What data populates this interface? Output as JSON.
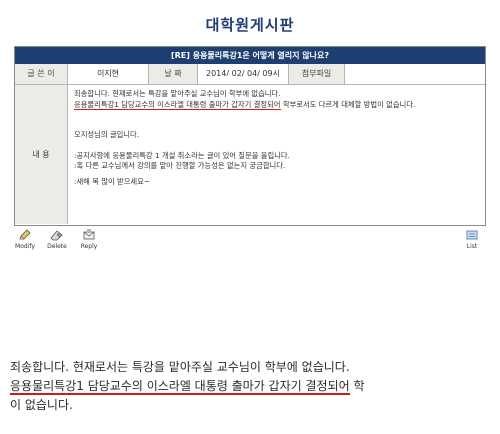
{
  "board": {
    "title": "대학원게시판"
  },
  "post": {
    "subject": "[RE] 응용물리특강1은 어떻게 열리지 않나요?",
    "meta": {
      "author_label": "글 쓴 이",
      "author": "이지현",
      "date_label": "날 짜",
      "date": "2014/ 02/ 04/ 09시",
      "attach_label": "첨부파일",
      "attach_value": ""
    },
    "content_label": "내 용",
    "content": {
      "line1": "죄송합니다. 현재로서는 특강을 맡아주실 교수님이 학부에 없습니다.",
      "line2_underlined": "응용물리특강1 담당교수의 이스라엘 대통령 출마가 갑자기 결정되어",
      "line2_rest": " 학부로서도 다르게 대체할 방법이 없습니다.",
      "line3": "오지성님의 글입니다.",
      "line4": ":공지사항에 응용물리특강 1 개설 취소라는 글이 있어 질문을 올립니다.",
      "line5": ":혹 다른 교수님께서 강의를 맡아 진행할 가능성은 없는지 궁금합니다.",
      "line6": ":새해 복 많이 받으세요~"
    }
  },
  "actions": {
    "modify_label": "Modify",
    "delete_label": "Delete",
    "reply_label": "Reply",
    "list_label": "List"
  },
  "zoom": {
    "line1": "죄송합니다. 현재로서는 특강을 맡아주실 교수님이 학부에 없습니다.",
    "line2_underlined": "응용물리특강1 담당교수의 이스라엘 대통령 출마가 갑자기 결정되어",
    "line2_rest": " 학",
    "line3": "이 없습니다."
  },
  "colors": {
    "header": "#1d3f72",
    "underline": "#d11a1a",
    "label_bg": "#ecebe6"
  }
}
